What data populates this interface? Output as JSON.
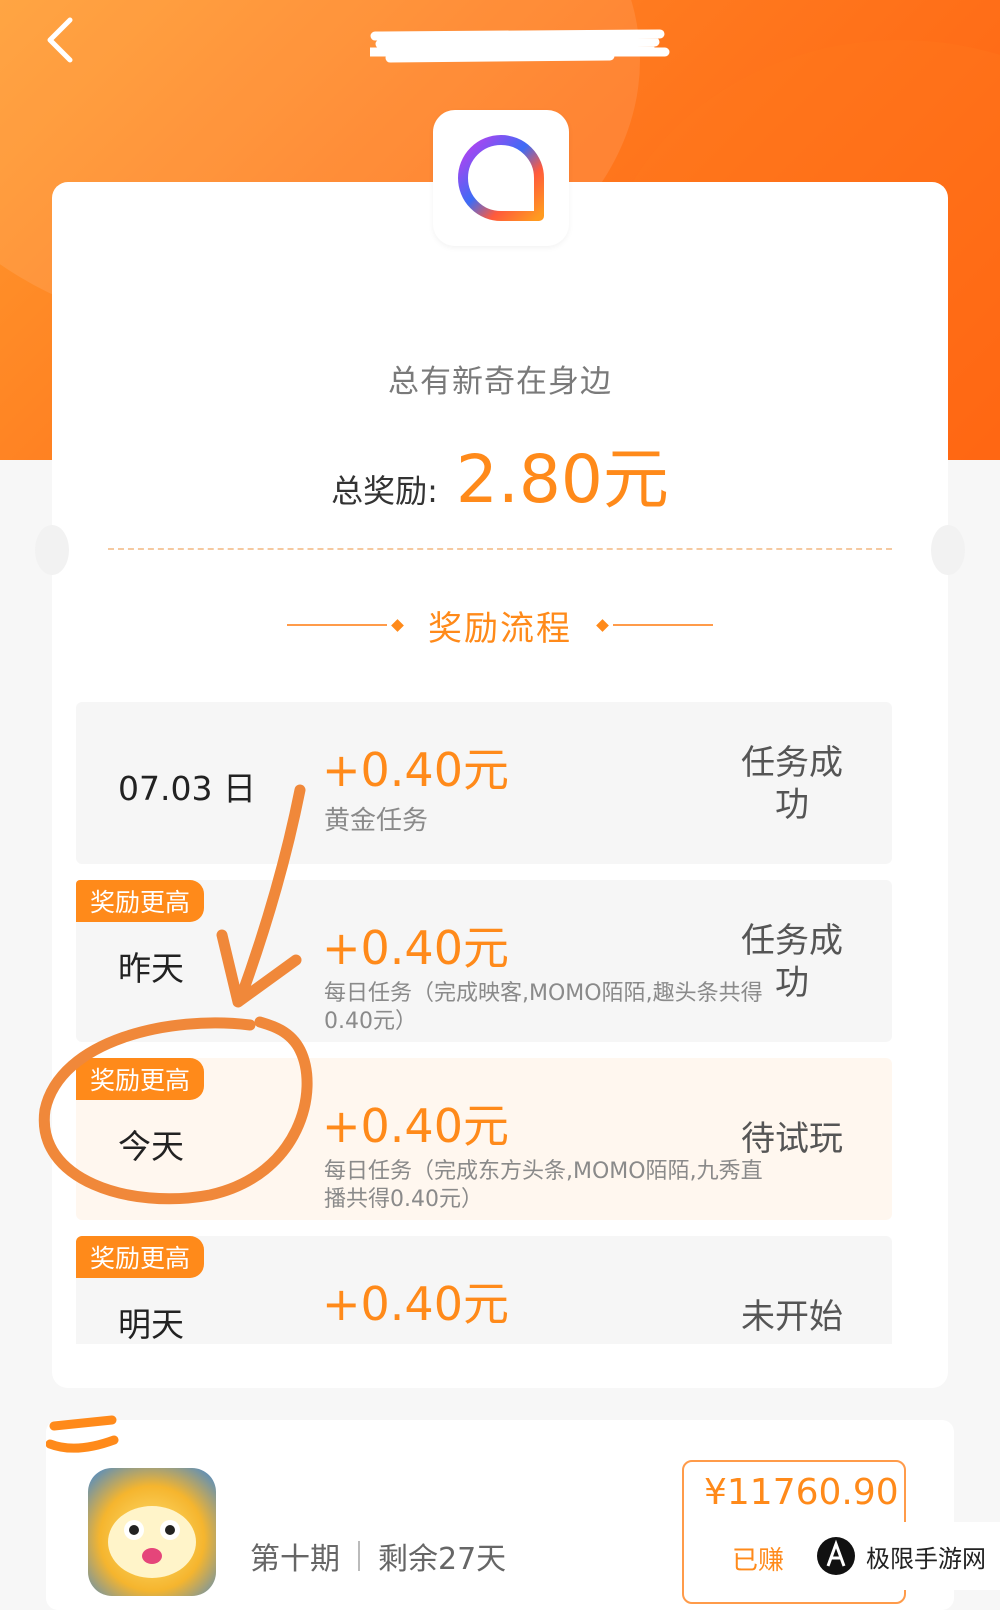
{
  "header": {
    "title": ""
  },
  "summary": {
    "slogan": "总有新奇在身边",
    "total_label": "总奖励:",
    "total_value": "2.80元"
  },
  "section_title": "奖励流程",
  "rows": [
    {
      "badge": "",
      "day": "07.03 日",
      "amount": "+0.40元",
      "desc": "黄金任务",
      "status": "任务成功"
    },
    {
      "badge": "奖励更高",
      "day": "昨天",
      "amount": "+0.40元",
      "desc": "每日任务（完成映客,MOMO陌陌,趣头条共得0.40元）",
      "status": "任务成功"
    },
    {
      "badge": "奖励更高",
      "day": "今天",
      "amount": "+0.40元",
      "desc": "每日任务（完成东方头条,MOMO陌陌,九秀直播共得0.40元）",
      "status": "待试玩"
    },
    {
      "badge": "奖励更高",
      "day": "明天",
      "amount": "+0.40元",
      "desc": "",
      "status": "未开始"
    }
  ],
  "bottom": {
    "period": "第十期",
    "remaining": "剩余27天",
    "earn_amount": "¥11760.90",
    "earn_label": "已赚"
  },
  "watermark": {
    "text": "极限手游网"
  },
  "colors": {
    "accent": "#ff8a1a",
    "hero": "#ff7a1f",
    "annotation": "#f0883a"
  }
}
